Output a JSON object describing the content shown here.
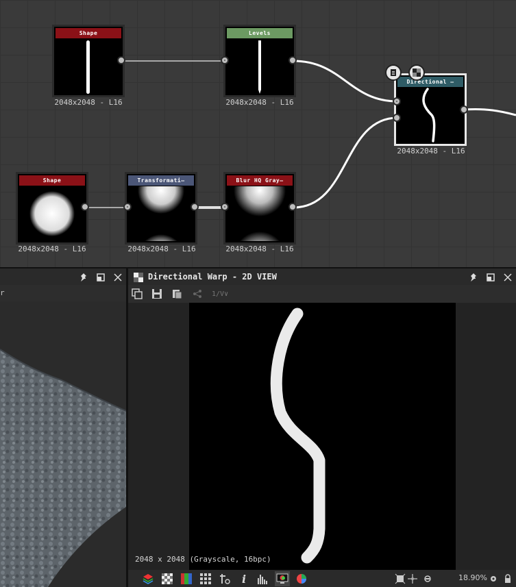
{
  "graph": {
    "nodes": [
      {
        "title": "Shape",
        "color": "#8b1117",
        "res": "2048x2048 - L16"
      },
      {
        "title": "Levels",
        "color": "#6c9a62",
        "res": "2048x2048 - L16"
      },
      {
        "title": "Directional —",
        "color": "#2f5c66",
        "res": "2048x2048 - L16"
      },
      {
        "title": "Shape",
        "color": "#8b1117",
        "res": "2048x2048 - L16"
      },
      {
        "title": "Transformati—",
        "color": "#4b5677",
        "res": "2048x2048 - L16"
      },
      {
        "title": "Blur HQ Gray—",
        "color": "#8b1117",
        "res": "2048x2048 - L16"
      }
    ]
  },
  "left_panel": {
    "sub_label": "r"
  },
  "view2d": {
    "title": "Directional Warp - 2D VIEW",
    "toolbar_version_label": "1/V",
    "image_info": "2048 x 2048 (Grayscale, 16bpc)",
    "zoom": "18.90%"
  },
  "icons": {
    "pin": "pin-icon",
    "float": "float-icon",
    "close": "close-icon",
    "view2d": "view-2d-icon"
  }
}
